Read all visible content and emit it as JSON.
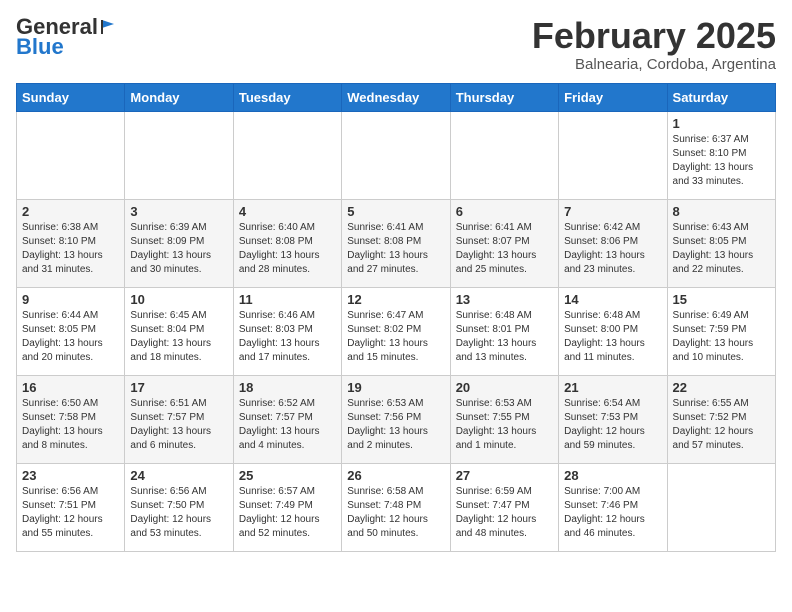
{
  "header": {
    "logo_general": "General",
    "logo_blue": "Blue",
    "month_title": "February 2025",
    "location": "Balnearia, Cordoba, Argentina"
  },
  "weekdays": [
    "Sunday",
    "Monday",
    "Tuesday",
    "Wednesday",
    "Thursday",
    "Friday",
    "Saturday"
  ],
  "weeks": [
    [
      {
        "day": "",
        "info": ""
      },
      {
        "day": "",
        "info": ""
      },
      {
        "day": "",
        "info": ""
      },
      {
        "day": "",
        "info": ""
      },
      {
        "day": "",
        "info": ""
      },
      {
        "day": "",
        "info": ""
      },
      {
        "day": "1",
        "info": "Sunrise: 6:37 AM\nSunset: 8:10 PM\nDaylight: 13 hours\nand 33 minutes."
      }
    ],
    [
      {
        "day": "2",
        "info": "Sunrise: 6:38 AM\nSunset: 8:10 PM\nDaylight: 13 hours\nand 31 minutes."
      },
      {
        "day": "3",
        "info": "Sunrise: 6:39 AM\nSunset: 8:09 PM\nDaylight: 13 hours\nand 30 minutes."
      },
      {
        "day": "4",
        "info": "Sunrise: 6:40 AM\nSunset: 8:08 PM\nDaylight: 13 hours\nand 28 minutes."
      },
      {
        "day": "5",
        "info": "Sunrise: 6:41 AM\nSunset: 8:08 PM\nDaylight: 13 hours\nand 27 minutes."
      },
      {
        "day": "6",
        "info": "Sunrise: 6:41 AM\nSunset: 8:07 PM\nDaylight: 13 hours\nand 25 minutes."
      },
      {
        "day": "7",
        "info": "Sunrise: 6:42 AM\nSunset: 8:06 PM\nDaylight: 13 hours\nand 23 minutes."
      },
      {
        "day": "8",
        "info": "Sunrise: 6:43 AM\nSunset: 8:05 PM\nDaylight: 13 hours\nand 22 minutes."
      }
    ],
    [
      {
        "day": "9",
        "info": "Sunrise: 6:44 AM\nSunset: 8:05 PM\nDaylight: 13 hours\nand 20 minutes."
      },
      {
        "day": "10",
        "info": "Sunrise: 6:45 AM\nSunset: 8:04 PM\nDaylight: 13 hours\nand 18 minutes."
      },
      {
        "day": "11",
        "info": "Sunrise: 6:46 AM\nSunset: 8:03 PM\nDaylight: 13 hours\nand 17 minutes."
      },
      {
        "day": "12",
        "info": "Sunrise: 6:47 AM\nSunset: 8:02 PM\nDaylight: 13 hours\nand 15 minutes."
      },
      {
        "day": "13",
        "info": "Sunrise: 6:48 AM\nSunset: 8:01 PM\nDaylight: 13 hours\nand 13 minutes."
      },
      {
        "day": "14",
        "info": "Sunrise: 6:48 AM\nSunset: 8:00 PM\nDaylight: 13 hours\nand 11 minutes."
      },
      {
        "day": "15",
        "info": "Sunrise: 6:49 AM\nSunset: 7:59 PM\nDaylight: 13 hours\nand 10 minutes."
      }
    ],
    [
      {
        "day": "16",
        "info": "Sunrise: 6:50 AM\nSunset: 7:58 PM\nDaylight: 13 hours\nand 8 minutes."
      },
      {
        "day": "17",
        "info": "Sunrise: 6:51 AM\nSunset: 7:57 PM\nDaylight: 13 hours\nand 6 minutes."
      },
      {
        "day": "18",
        "info": "Sunrise: 6:52 AM\nSunset: 7:57 PM\nDaylight: 13 hours\nand 4 minutes."
      },
      {
        "day": "19",
        "info": "Sunrise: 6:53 AM\nSunset: 7:56 PM\nDaylight: 13 hours\nand 2 minutes."
      },
      {
        "day": "20",
        "info": "Sunrise: 6:53 AM\nSunset: 7:55 PM\nDaylight: 13 hours\nand 1 minute."
      },
      {
        "day": "21",
        "info": "Sunrise: 6:54 AM\nSunset: 7:53 PM\nDaylight: 12 hours\nand 59 minutes."
      },
      {
        "day": "22",
        "info": "Sunrise: 6:55 AM\nSunset: 7:52 PM\nDaylight: 12 hours\nand 57 minutes."
      }
    ],
    [
      {
        "day": "23",
        "info": "Sunrise: 6:56 AM\nSunset: 7:51 PM\nDaylight: 12 hours\nand 55 minutes."
      },
      {
        "day": "24",
        "info": "Sunrise: 6:56 AM\nSunset: 7:50 PM\nDaylight: 12 hours\nand 53 minutes."
      },
      {
        "day": "25",
        "info": "Sunrise: 6:57 AM\nSunset: 7:49 PM\nDaylight: 12 hours\nand 52 minutes."
      },
      {
        "day": "26",
        "info": "Sunrise: 6:58 AM\nSunset: 7:48 PM\nDaylight: 12 hours\nand 50 minutes."
      },
      {
        "day": "27",
        "info": "Sunrise: 6:59 AM\nSunset: 7:47 PM\nDaylight: 12 hours\nand 48 minutes."
      },
      {
        "day": "28",
        "info": "Sunrise: 7:00 AM\nSunset: 7:46 PM\nDaylight: 12 hours\nand 46 minutes."
      },
      {
        "day": "",
        "info": ""
      }
    ]
  ]
}
